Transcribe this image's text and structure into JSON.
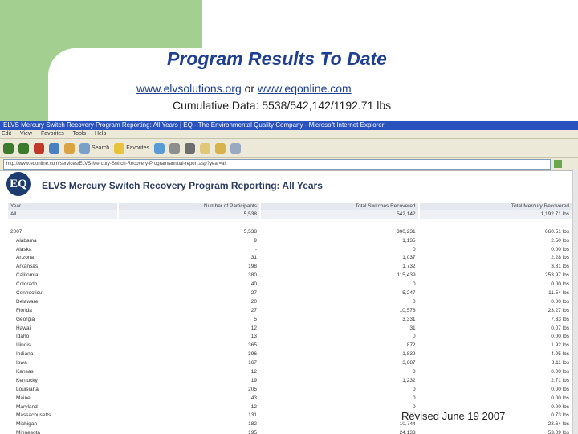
{
  "slide": {
    "title": "Program Results To Date",
    "link1": "www.elvsolutions.org",
    "link_sep": "or",
    "link2": "www.eqonline.com",
    "cumulative": "Cumulative Data: 5538/542,142/1192.71 lbs",
    "revised": "Revised June 19 2007"
  },
  "browser": {
    "window_title": "ELVS Mercury Switch Recovery Program Reporting: All Years | EQ - The Environmental Quality Company - Microsoft Internet Explorer",
    "menu": [
      "Edit",
      "View",
      "Favorites",
      "Tools",
      "Help"
    ],
    "toolbar": {
      "search_label": "Search",
      "favorites_label": "Favorites"
    },
    "address": "http://www.eqonline.com/services/ELVS-Mercury-Switch-Recovery-Program/annual-report.asp?year=all"
  },
  "report": {
    "logo_text": "EQ",
    "title": "ELVS Mercury Switch Recovery Program Reporting: All Years",
    "headers": [
      "Year",
      "Number of Participants",
      "Total Switches Recovered",
      "Total Mercury Recovered"
    ],
    "all_row": [
      "All",
      "5,538",
      "542,142",
      "1,192.71 lbs"
    ],
    "year_row": [
      "2007",
      "5,538",
      "300,231",
      "660.51 lbs"
    ],
    "rows": [
      [
        "Alabama",
        "9",
        "1,135",
        "2.50 lbs"
      ],
      [
        "Alaska",
        "-",
        "0",
        "0.00 lbs"
      ],
      [
        "Arizona",
        "31",
        "1,037",
        "2.28 lbs"
      ],
      [
        "Arkansas",
        "198",
        "1,732",
        "3.81 lbs"
      ],
      [
        "California",
        "380",
        "115,439",
        "253.97 lbs"
      ],
      [
        "Colorado",
        "40",
        "0",
        "0.00 lbs"
      ],
      [
        "Connecticut",
        "27",
        "5,247",
        "11.54 lbs"
      ],
      [
        "Delaware",
        "20",
        "0",
        "0.00 lbs"
      ],
      [
        "Florida",
        "27",
        "10,578",
        "23.27 lbs"
      ],
      [
        "Georgia",
        "5",
        "3,331",
        "7.33 lbs"
      ],
      [
        "Hawaii",
        "12",
        "31",
        "0.07 lbs"
      ],
      [
        "Idaho",
        "13",
        "0",
        "0.00 lbs"
      ],
      [
        "Illinois",
        "365",
        "872",
        "1.92 lbs"
      ],
      [
        "Indiana",
        "396",
        "1,839",
        "4.05 lbs"
      ],
      [
        "Iowa",
        "167",
        "3,687",
        "8.11 lbs"
      ],
      [
        "Kansas",
        "12",
        "0",
        "0.00 lbs"
      ],
      [
        "Kentucky",
        "19",
        "1,232",
        "2.71 lbs"
      ],
      [
        "Louisiana",
        "205",
        "0",
        "0.00 lbs"
      ],
      [
        "Maine",
        "43",
        "0",
        "0.00 lbs"
      ],
      [
        "Maryland",
        "12",
        "0",
        "0.00 lbs"
      ],
      [
        "Massachusetts",
        "131",
        "332",
        "0.73 lbs"
      ],
      [
        "Michigan",
        "182",
        "10,744",
        "23.64 lbs"
      ],
      [
        "Minnesota",
        "195",
        "24,133",
        "53.09 lbs"
      ]
    ]
  }
}
